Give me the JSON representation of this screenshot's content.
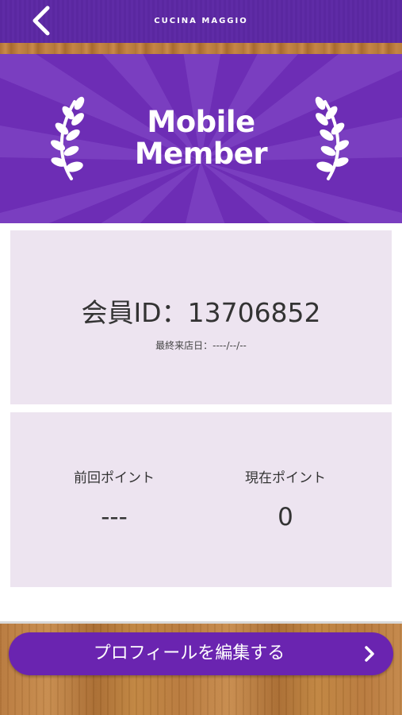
{
  "header": {
    "title": "CUCINA MAGGIO",
    "back_icon": "chevron-left-icon"
  },
  "banner": {
    "title_line1": "Mobile",
    "title_line2": "Member",
    "icon": "laurel-icon"
  },
  "member": {
    "id_text": "会員ID：13706852",
    "last_visit": "最終来店日：----/--/--"
  },
  "points": {
    "previous_label": "前回ポイント",
    "previous_value": "---",
    "current_label": "現在ポイント",
    "current_value": "0"
  },
  "action": {
    "edit_profile_label": "プロフィールを編集する",
    "chevron_icon": "chevron-right-icon"
  },
  "colors": {
    "brand_purple": "#6a24b0",
    "card_background": "#ede4f0"
  }
}
